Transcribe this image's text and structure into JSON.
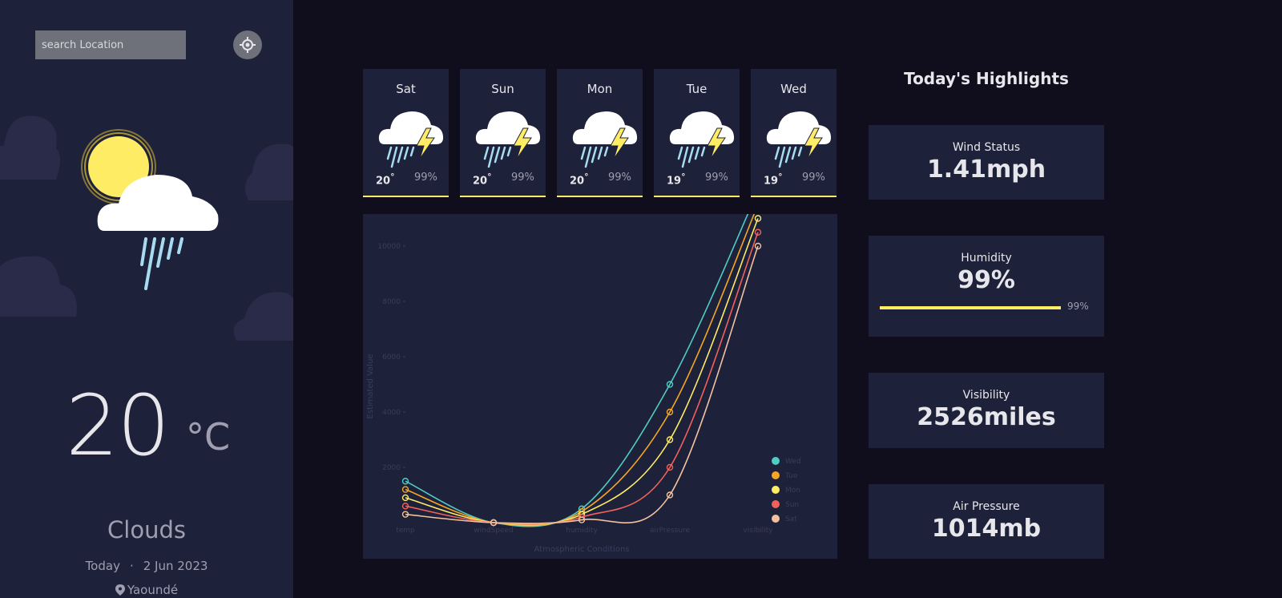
{
  "sidebar": {
    "search_placeholder": "search Location",
    "temperature": "20",
    "temperature_unit": "°C",
    "condition": "Clouds",
    "day_label": "Today",
    "separator": "·",
    "date": "2 Jun 2023",
    "location": "Yaoundé"
  },
  "forecast": [
    {
      "day": "Sat",
      "temp": "20",
      "humidity": "99%",
      "icon": "thunderstorm-icon"
    },
    {
      "day": "Sun",
      "temp": "20",
      "humidity": "99%",
      "icon": "thunderstorm-icon"
    },
    {
      "day": "Mon",
      "temp": "20",
      "humidity": "99%",
      "icon": "thunderstorm-icon"
    },
    {
      "day": "Tue",
      "temp": "19",
      "humidity": "99%",
      "icon": "thunderstorm-icon"
    },
    {
      "day": "Wed",
      "temp": "19",
      "humidity": "99%",
      "icon": "thunderstorm-icon"
    }
  ],
  "highlights": {
    "title": "Today's Highlights",
    "wind": {
      "label": "Wind Status",
      "value": "1.41mph"
    },
    "humidity": {
      "label": "Humidity",
      "value": "99%",
      "bar_label": "99%",
      "fraction": 0.99
    },
    "visibility": {
      "label": "Visibility",
      "value": "2526miles"
    },
    "pressure": {
      "label": "Air Pressure",
      "value": "1014mb"
    }
  },
  "chart_data": {
    "type": "line",
    "xlabel": "Atmospheric Conditions",
    "ylabel": "Estimated Value",
    "categories": [
      "temp",
      "windSpeed",
      "humidity",
      "airPressure",
      "visibility"
    ],
    "yticks": [
      2000,
      4000,
      6000,
      8000,
      10000
    ],
    "ylim": [
      0,
      10000
    ],
    "legend_position": "bottom-right",
    "series": [
      {
        "name": "Wed",
        "color": "#4ecdc4",
        "values": [
          1500,
          0,
          500,
          5000,
          12000
        ]
      },
      {
        "name": "Tue",
        "color": "#f5a623",
        "values": [
          1200,
          0,
          400,
          4000,
          11500
        ]
      },
      {
        "name": "Mon",
        "color": "#ffec65",
        "values": [
          900,
          0,
          300,
          3000,
          11000
        ]
      },
      {
        "name": "Sun",
        "color": "#f0625a",
        "values": [
          600,
          0,
          200,
          2000,
          10500
        ]
      },
      {
        "name": "Sat",
        "color": "#f2c2a0",
        "values": [
          300,
          0,
          100,
          1000,
          10000
        ]
      }
    ]
  },
  "colors": {
    "accent": "#ffec65",
    "sidebar_bg": "#1e213a",
    "page_bg": "#100e1d"
  }
}
